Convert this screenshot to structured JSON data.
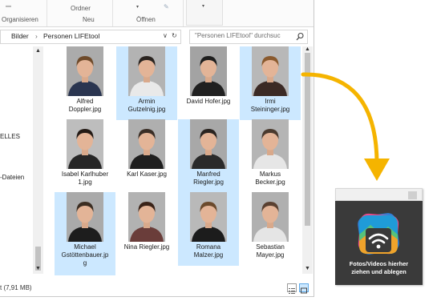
{
  "ribbon": {
    "organize": "Organisieren",
    "folder": "Ordner",
    "new": "Neu",
    "open": "Öffnen"
  },
  "address": {
    "crumbs": [
      "Bilder",
      "Personen LIFEtool"
    ],
    "sep": "›",
    "dropdown": "∨",
    "refresh": "↻"
  },
  "search": {
    "placeholder": "\"Personen LIFEtool\" durchsuc"
  },
  "nav": {
    "items": [
      "ELLES",
      "-Dateien"
    ]
  },
  "files": [
    {
      "name": "Alfred Doppler.jpg",
      "selected": false,
      "hair": "#6e4a2a",
      "shirt": "#2a3550",
      "bg": "#ababab"
    },
    {
      "name": "Armin Gutzelnig.jpg",
      "selected": true,
      "hair": "#2a2420",
      "shirt": "#e9e9e9",
      "bg": "#b3b3b3"
    },
    {
      "name": "David Hofer.jpg",
      "selected": false,
      "hair": "#1e1e1e",
      "shirt": "#202020",
      "bg": "#a3a3a3"
    },
    {
      "name": "Irmi Steininger.jpg",
      "selected": true,
      "hair": "#8a5a2e",
      "shirt": "#3b2a25",
      "bg": "#b8b8b8"
    },
    {
      "name": "Isabel Karlhuber 1.jpg",
      "selected": false,
      "hair": "#231a15",
      "shirt": "#262626",
      "bg": "#bdbdbd"
    },
    {
      "name": "Karl Kaser.jpg",
      "selected": false,
      "hair": "#3a2e26",
      "shirt": "#1f1f1f",
      "bg": "#afafaf"
    },
    {
      "name": "Manfred Riegler.jpg",
      "selected": true,
      "hair": "#2a2420",
      "shirt": "#2a2a2a",
      "bg": "#a8a8a8"
    },
    {
      "name": "Markus Becker.jpg",
      "selected": false,
      "hair": "#4a3a2e",
      "shirt": "#e6e6e6",
      "bg": "#b5b5b5"
    },
    {
      "name": "Michael Gstöttenbauer.jpg",
      "selected": true,
      "hair": "#3b2d22",
      "shirt": "#1d1d1d",
      "bg": "#aaaaaa"
    },
    {
      "name": "Nina Riegler.jpg",
      "selected": false,
      "hair": "#3a2318",
      "shirt": "#6a3d3a",
      "bg": "#b2b2b2"
    },
    {
      "name": "Romana Malzer.jpg",
      "selected": true,
      "hair": "#6b4a2c",
      "shirt": "#1c1c1c",
      "bg": "#b9b9b9"
    },
    {
      "name": "Sebastian Mayer.jpg",
      "selected": false,
      "hair": "#5a4030",
      "shirt": "#e5e5e5",
      "bg": "#b0b0b0"
    }
  ],
  "captions": [
    [
      "Alfred",
      "Doppler.jpg"
    ],
    [
      "Armin",
      "Gutzelnig.jpg"
    ],
    [
      "David Hofer.jpg"
    ],
    [
      "Irmi",
      "Steininger.jpg"
    ],
    [
      "Isabel Karlhuber",
      "1.jpg"
    ],
    [
      "Karl Kaser.jpg"
    ],
    [
      "Manfred",
      "Riegler.jpg"
    ],
    [
      "Markus",
      "Becker.jpg"
    ],
    [
      "Michael",
      "Gstöttenbauer.jp",
      "g"
    ],
    [
      "Nina Riegler.jpg"
    ],
    [
      "Romana",
      "Malzer.jpg"
    ],
    [
      "Sebastian",
      "Mayer.jpg"
    ]
  ],
  "status": {
    "info": "t (7,91 MB)"
  },
  "widget": {
    "line1": "Fotos/Videos hierher",
    "line2": "ziehen und ablegen"
  },
  "colors": {
    "selection": "#cce8ff",
    "arrow": "#f5b400",
    "widget_bg": "#3a3a3a"
  },
  "icons": {
    "search": "search-icon",
    "scroll_up": "chevron-up-icon",
    "scroll_down": "chevron-down-icon",
    "details_view": "details-view-icon",
    "large_icons_view": "large-icons-view-icon",
    "photo_transfer": "photo-wifi-icon"
  }
}
